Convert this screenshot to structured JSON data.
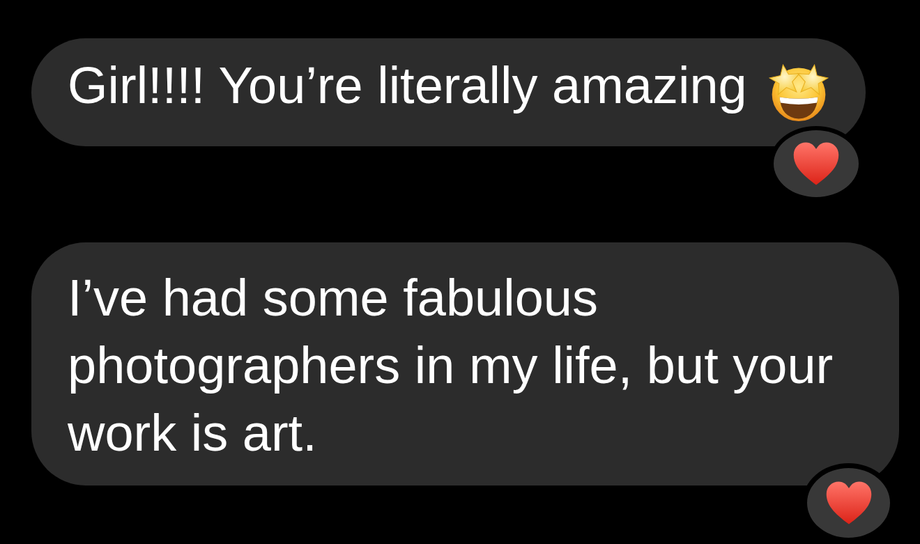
{
  "messages": [
    {
      "text": "Girl!!!! You’re literally amazing",
      "emoji_after": true,
      "reacted": true
    },
    {
      "text": "I’ve had some fabulous photographers in my life, but your work is art.",
      "emoji_after": false,
      "reacted": true
    }
  ]
}
